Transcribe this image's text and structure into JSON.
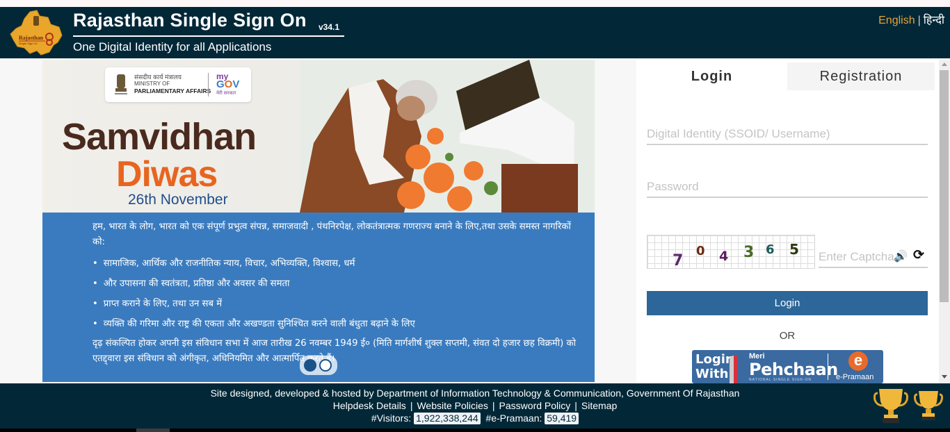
{
  "header": {
    "title": "Rajasthan Single Sign On",
    "version": "v34.1",
    "subtitle": "One Digital Identity for all Applications",
    "logo_text": "Rajasthan",
    "logo_subtext": "Single Sign On",
    "lang_english": "English",
    "lang_separator": "|",
    "lang_hindi": "हिन्दी"
  },
  "banner": {
    "ministry_hindi": "संसदीय कार्य मंत्रालय",
    "ministry_line1": "MINISTRY OF",
    "ministry_line2": "PARLIAMENTARY AFFAIRS",
    "mygov_my": "my",
    "mygov_gov_g": "G",
    "mygov_gov_o": "O",
    "mygov_gov_v": "V",
    "mygov_tag": "मेरी सरकार",
    "headline1": "Samvidhan",
    "headline2": "Diwas",
    "date": "26th November",
    "preamble_intro": "हम, भारत के लोग, भारत को एक संपूर्ण प्रभुत्व संपन्न, समाजवादी , पंथनिरपेक्ष, लोकतंत्रात्मक गणराज्य बनाने के लिए,तथा उसके समस्त नागरिकों को:",
    "preamble_points": [
      "सामाजिक, आर्थिक और राजनीतिक न्याय, विचार, अभिव्यक्ति, विश्वास, धर्म",
      "और उपासना की स्वतंत्रता, प्रतिष्ठा और अवसर की समता",
      "प्राप्त कराने के लिए, तथा उन सब में",
      "व्यक्ति की गरिमा और राष्ट्र की एकता और अखण्डता सुनिश्चित करने वाली बंधुता बढ़ाने के लिए"
    ],
    "preamble_close": "दृढ़ संकल्पित होकर अपनी इस संविधान सभा में आज तारीख 26 नवम्बर 1949 ई० (मिति मार्गशीर्ष शुक्ल सप्तमी, संवत दो हजार छह विक्रमी) को एतद्द्वारा इस संविधान को अंगीकृत, अधिनियमित और आत्मार्पित करते हैं।",
    "carousel_active_index": 1,
    "carousel_total": 2
  },
  "login": {
    "tab_login": "Login",
    "tab_registration": "Registration",
    "username_placeholder": "Digital Identity (SSOID/ Username)",
    "username_value": "",
    "password_placeholder": "Password",
    "password_value": "",
    "captcha_digits": [
      "7",
      "0",
      "4",
      "3",
      "6",
      "5"
    ],
    "captcha_colors": [
      "#5a2a6a",
      "#6a2a10",
      "#5a2060",
      "#4a6a2a",
      "#1f5a55",
      "#2a3a10"
    ],
    "captcha_placeholder": "Enter Captcha",
    "captcha_value": "",
    "audio_icon": "🔊",
    "refresh_icon": "⟳",
    "login_button": "Login",
    "or_text": "OR",
    "pehchaan_login": "Login",
    "pehchaan_with": "With",
    "pehchaan_meri": "Meri",
    "pehchaan_name": "Pehchaan",
    "pehchaan_tagline": "NATIONAL SINGLE SIGN-ON",
    "pehchaan_e": "e",
    "pehchaan_epramaan": "e-Pramaan"
  },
  "footer": {
    "credit": "Site designed, developed & hosted by Department of Information Technology & Communication, Government Of Rajasthan",
    "links": [
      "Helpdesk Details",
      "Website Policies",
      "Password Policy",
      "Sitemap"
    ],
    "link_separator": "|",
    "visitors_label": "#Visitors:",
    "visitors_count": "1,922,338,244",
    "epramaan_label": "#e-Pramaan:",
    "epramaan_count": "59,419"
  }
}
